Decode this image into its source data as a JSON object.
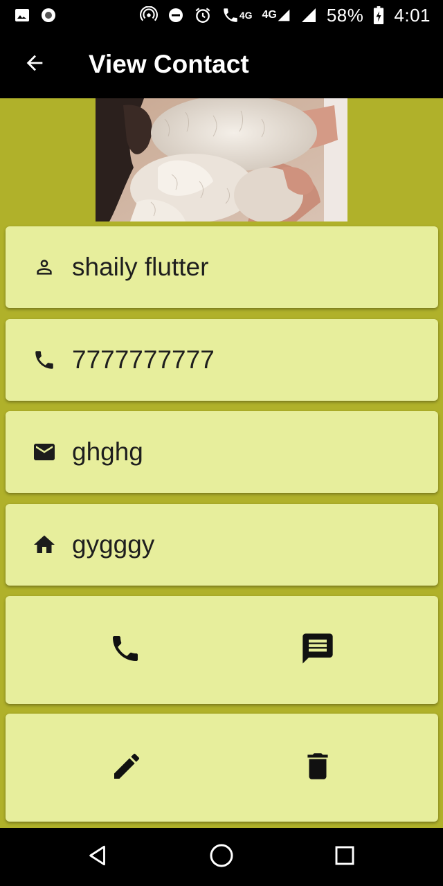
{
  "status_bar": {
    "left_icons": [
      "image-icon",
      "record-icon"
    ],
    "right_icons": [
      "hotspot-icon",
      "dnd-icon",
      "alarm-icon",
      "wifi-call-icon",
      "signal-4g-icon",
      "signal-icon",
      "battery-icon"
    ],
    "network_small": "4G",
    "network_label": "4G",
    "battery": "58%",
    "time": "4:01"
  },
  "app_bar": {
    "title": "View Contact",
    "back_icon": "arrow-back-icon"
  },
  "photo": {
    "description_icon": "contact-photo"
  },
  "contact": {
    "name": "shaily flutter",
    "phone": "7777777777",
    "email": "ghghg",
    "address": "gygggy"
  },
  "icons": {
    "name": "person-icon",
    "phone": "phone-icon",
    "email": "mail-icon",
    "address": "home-icon",
    "call": "call-icon",
    "message": "message-icon",
    "edit": "edit-icon",
    "delete": "delete-icon"
  },
  "colors": {
    "background": "#b0b12a",
    "card": "#e7ee9c",
    "bar": "#000000",
    "text": "#1c1c1c"
  },
  "nav_bar": {
    "icons": [
      "back-triangle-icon",
      "home-circle-icon",
      "recents-square-icon"
    ]
  }
}
